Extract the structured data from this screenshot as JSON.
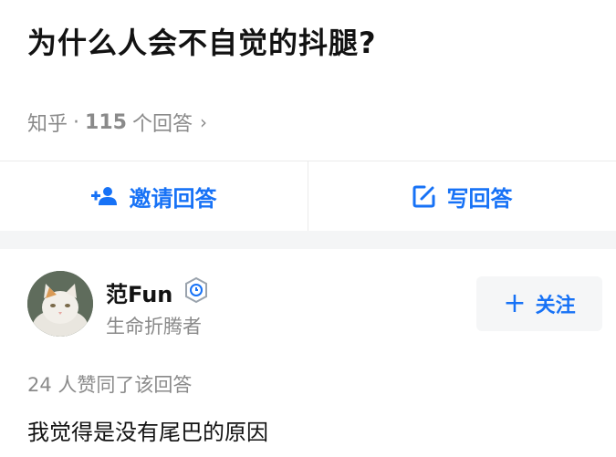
{
  "question": {
    "title": "为什么人会不自觉的抖腿?"
  },
  "meta": {
    "source": "知乎",
    "separator": "·",
    "answer_count": "115",
    "answer_suffix": "个回答",
    "chevron": "›"
  },
  "actions": {
    "invite_label": "邀请回答",
    "write_label": "写回答",
    "invite_icon": "add-user-icon",
    "write_icon": "edit-icon"
  },
  "answer": {
    "author_name": "范Fun",
    "author_bio": "生命折腾者",
    "badge_icon": "verified-badge-icon",
    "follow_label": "关注",
    "follow_plus": "+",
    "upvote_text": "24 人赞同了该回答",
    "content": "我觉得是没有尾巴的原因"
  },
  "colors": {
    "accent": "#1772f6",
    "muted": "#8a8a8a",
    "band": "#f4f5f6"
  }
}
